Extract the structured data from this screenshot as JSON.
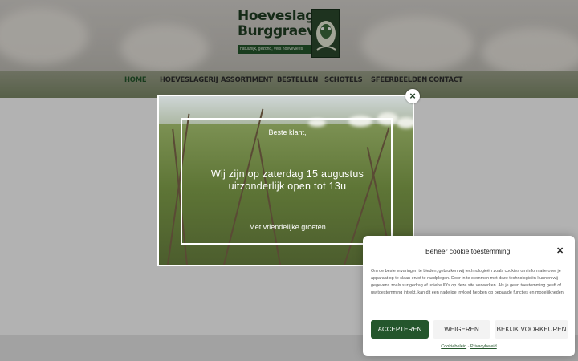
{
  "logo": {
    "line1": "Hoeveslagerij",
    "line2": "Burggraeve",
    "tagline": "natuurlijk, gezond, vers hoevevlees"
  },
  "nav": {
    "items": [
      "HOME",
      "HOEVESLAGERIJ",
      "ASSORTIMENT",
      "BESTELLEN",
      "SCHOTELS",
      "SFEERBEELDEN",
      "CONTACT"
    ],
    "active": "HOME"
  },
  "popup": {
    "greeting": "Beste klant,",
    "message_line1": "Wij zijn op zaterdag 15 augustus",
    "message_line2": "uitzonderlijk open tot 13u",
    "signoff": "Met vriendelijke groeten",
    "close_icon": "×"
  },
  "cookie": {
    "title": "Beheer cookie toestemming",
    "close_icon": "✕",
    "body": "Om de beste ervaringen te bieden, gebruiken wij technologieën zoals cookies om informatie over je apparaat op te slaan en/of te raadplegen. Door in te stemmen met deze technologieën kunnen wij gegevens zoals surfgedrag of unieke ID's op deze site verwerken. Als je geen toestemming geeft of uw toestemming intrekt, kan dit een nadelige invloed hebben op bepaalde functies en mogelijkheden.",
    "accept_label": "ACCEPTEREN",
    "deny_label": "WEIGEREN",
    "prefs_label": "BEKIJK VOORKEUREN",
    "link_cookie": "Cookiebeleid",
    "link_separator": "-",
    "link_privacy": "Privacybeleid"
  },
  "colors": {
    "brand_green": "#24562c",
    "overlay": "rgba(0,0,0,0.30)"
  }
}
